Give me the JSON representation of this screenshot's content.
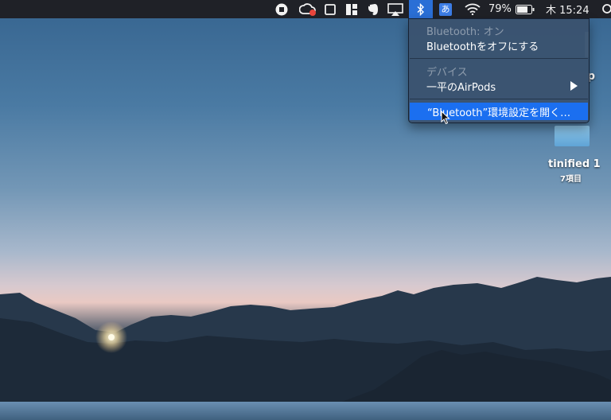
{
  "menubar": {
    "items": [
      {
        "name": "screen-record-stop-icon"
      },
      {
        "name": "creative-cloud-icon"
      },
      {
        "name": "window-icon"
      },
      {
        "name": "layout-tile-icon"
      },
      {
        "name": "evernote-icon"
      },
      {
        "name": "airplay-icon"
      },
      {
        "name": "bluetooth-icon"
      },
      {
        "name": "input-method-icon",
        "label": "あ"
      },
      {
        "name": "wifi-icon"
      },
      {
        "name": "spotlight-search-icon"
      }
    ],
    "battery": "79%",
    "clock": "木 15:24"
  },
  "bluetooth_menu": {
    "status": "Bluetooth: オン",
    "toggle": "Bluetoothをオフにする",
    "devices_header": "デバイス",
    "device": "一平のAirPods",
    "open_prefs": "“Bluetooth”環境設定を開く…"
  },
  "desktop": {
    "partial_label_top": "p",
    "folder_label": "tinified 1",
    "folder_count": "7項目"
  },
  "colors": {
    "menubar": "#1f2127",
    "selected": "#1b6ff0",
    "menu_bg": "#3a526e"
  }
}
